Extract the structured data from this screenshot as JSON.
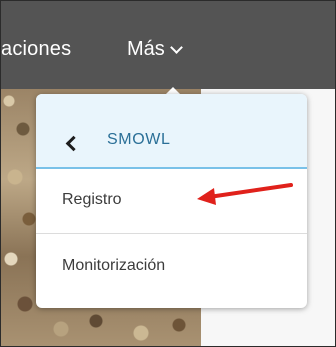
{
  "navbar": {
    "partial_item_label": "aciones",
    "more_label": "Más"
  },
  "dropdown": {
    "header_label": "SMOWL",
    "items": [
      {
        "label": "Registro"
      },
      {
        "label": "Monitorización"
      }
    ]
  },
  "colors": {
    "navbar": "#545454",
    "header_bg": "#e9f5fc",
    "header_border": "#79c1e8",
    "header_text": "#2a6f97",
    "annotation_arrow": "#e0211b"
  },
  "icons": {
    "back": "chevron-left-icon",
    "more_dropdown": "chevron-down-icon",
    "annotation": "red-arrow-icon"
  }
}
